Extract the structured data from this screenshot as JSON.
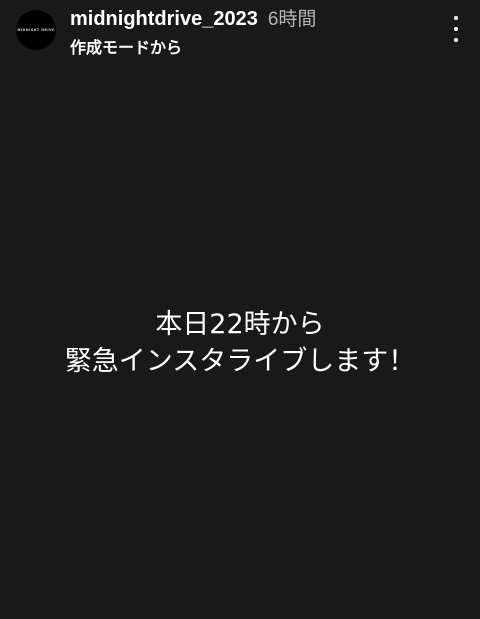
{
  "header": {
    "avatar_text": "MIDNIGHT DRIVE",
    "username": "midnightdrive_2023",
    "time_ago": "6時間",
    "subtitle": "作成モードから"
  },
  "icons": {
    "more": "more-vertical-icon"
  },
  "story": {
    "caption_lines": [
      "本日22時から",
      "緊急インスタライブします！"
    ]
  },
  "colors": {
    "background": "#191919",
    "text": "#ffffff",
    "muted": "#b3b3b3",
    "avatar_bg": "#000000"
  }
}
